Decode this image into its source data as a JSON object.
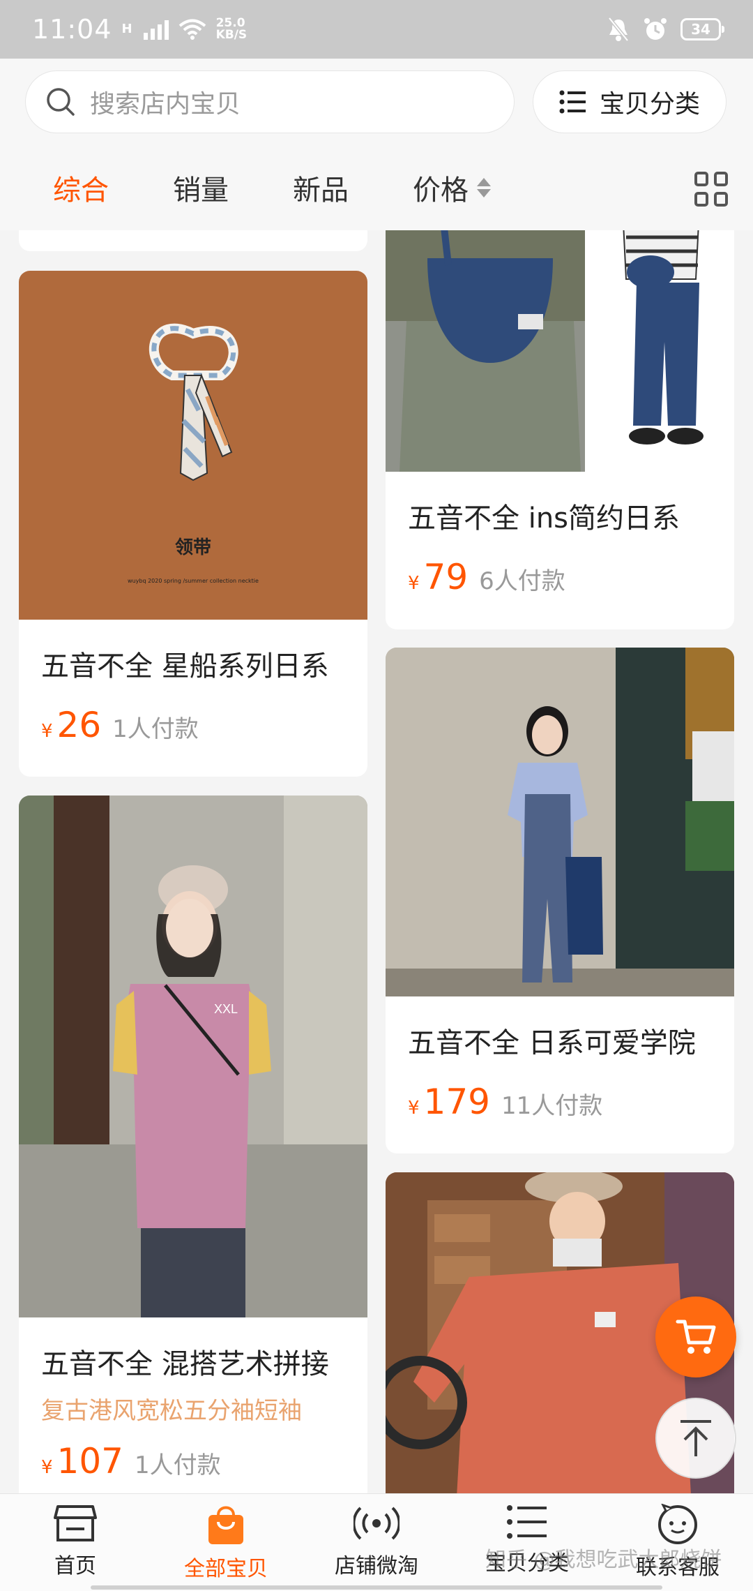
{
  "status_bar": {
    "time": "11:04",
    "network_speed_value": "25.0",
    "network_speed_unit": "KB/S",
    "battery": "34"
  },
  "search": {
    "placeholder": "搜索店内宝贝",
    "category_button": "宝贝分类"
  },
  "sort_tabs": [
    {
      "label": "综合",
      "active": true
    },
    {
      "label": "销量",
      "active": false
    },
    {
      "label": "新品",
      "active": false
    },
    {
      "label": "价格",
      "active": false
    }
  ],
  "products": {
    "necktie": {
      "image_caption": "领带",
      "image_subcaption": "wuybq 2020 spring /summer collection necktie",
      "title": "五音不全 星船系列日系",
      "currency": "¥",
      "price": "26",
      "paid": "1人付款"
    },
    "tshirt": {
      "title": "五音不全 混搭艺术拼接",
      "subtitle": "复古港风宽松五分袖短袖",
      "currency": "¥",
      "price": "107",
      "paid": "1人付款",
      "shirt_text": "XXL"
    },
    "bag": {
      "title": "五音不全 ins简约日系",
      "currency": "¥",
      "price": "79",
      "paid": "6人付款"
    },
    "overalls": {
      "title": "五音不全 日系可爱学院",
      "currency": "¥",
      "price": "179",
      "paid": "11人付款"
    }
  },
  "bottom_nav": [
    {
      "label": "首页",
      "icon": "store-icon",
      "active": false
    },
    {
      "label": "全部宝贝",
      "icon": "shopping-bag-icon",
      "active": true
    },
    {
      "label": "店铺微淘",
      "icon": "broadcast-icon",
      "active": false
    },
    {
      "label": "宝贝分类",
      "icon": "list-icon",
      "active": false
    },
    {
      "label": "联系客服",
      "icon": "chat-face-icon",
      "active": false
    }
  ],
  "watermark": "知乎 @我想吃武大郎烧饼",
  "colors": {
    "accent": "#ff5500",
    "subtitle": "#e9a36e",
    "necktie_bg": "#b06a3c"
  }
}
